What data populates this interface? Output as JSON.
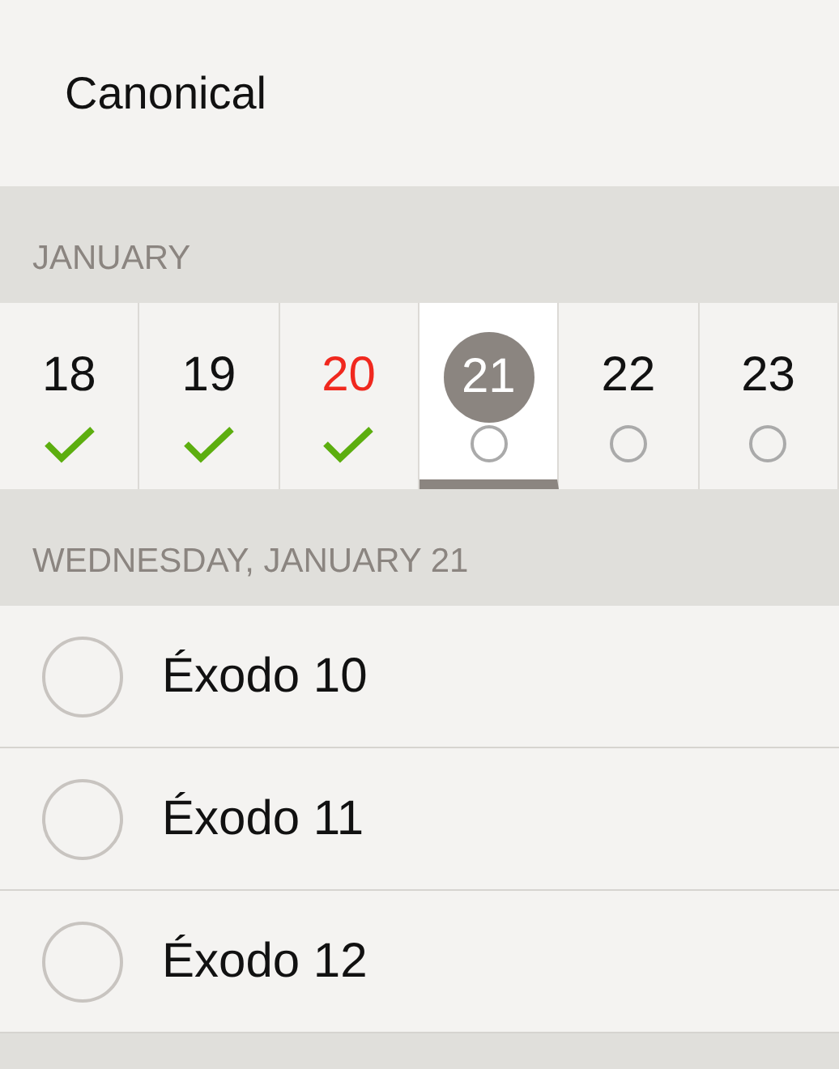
{
  "title": "Canonical",
  "month": "JANUARY",
  "days": [
    {
      "day": "18",
      "kind": "done",
      "today": false,
      "selected": false
    },
    {
      "day": "19",
      "kind": "done",
      "today": false,
      "selected": false
    },
    {
      "day": "20",
      "kind": "done",
      "today": true,
      "selected": false
    },
    {
      "day": "21",
      "kind": "open",
      "today": false,
      "selected": true
    },
    {
      "day": "22",
      "kind": "open",
      "today": false,
      "selected": false
    },
    {
      "day": "23",
      "kind": "open",
      "today": false,
      "selected": false
    }
  ],
  "date_heading": "WEDNESDAY, JANUARY 21",
  "readings": [
    {
      "label": "Éxodo 10",
      "checked": false
    },
    {
      "label": "Éxodo 11",
      "checked": false
    },
    {
      "label": "Éxodo 12",
      "checked": false
    }
  ]
}
